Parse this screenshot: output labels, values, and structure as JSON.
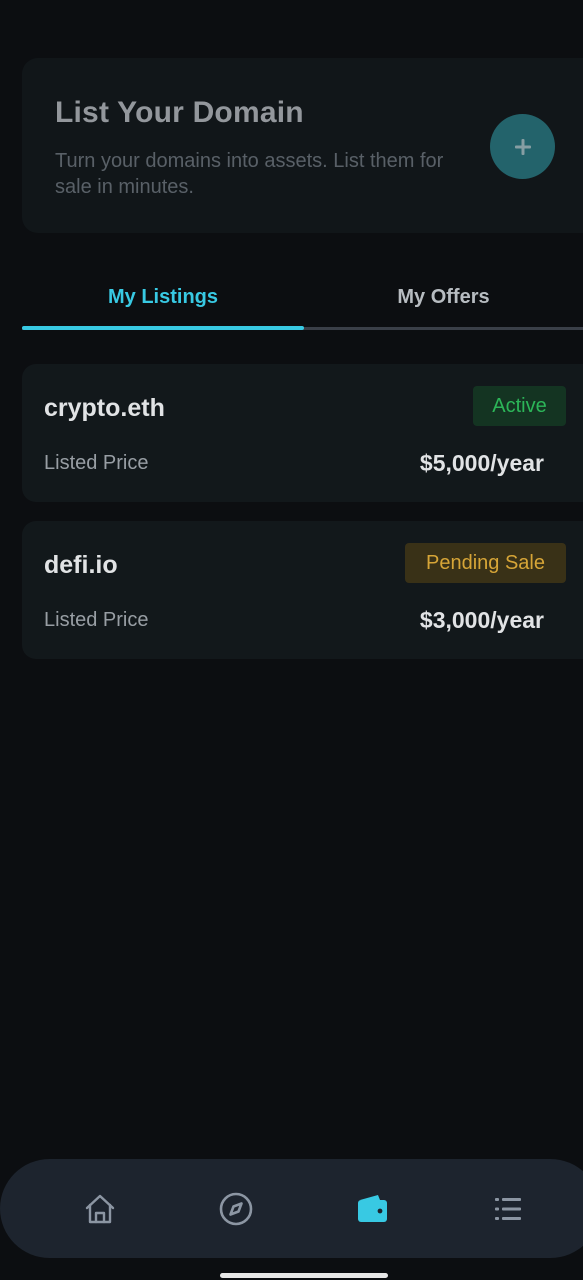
{
  "promo": {
    "title": "List Your Domain",
    "description": "Turn your domains into assets. List them for sale in minutes.",
    "add_icon": "plus-icon"
  },
  "tabs": [
    {
      "label": "My Listings",
      "active": true
    },
    {
      "label": "My Offers",
      "active": false
    }
  ],
  "listings": [
    {
      "domain": "crypto.eth",
      "status": "Active",
      "price_label": "Listed Price",
      "price": "$5,000/year"
    },
    {
      "domain": "defi.io",
      "status": "Pending Sale",
      "price_label": "Listed Price",
      "price": "$3,000/year"
    }
  ],
  "nav": {
    "items": [
      {
        "icon": "home-icon",
        "active": false
      },
      {
        "icon": "compass-icon",
        "active": false
      },
      {
        "icon": "wallet-icon",
        "active": true
      },
      {
        "icon": "list-icon",
        "active": false
      }
    ]
  },
  "colors": {
    "accent": "#38c9e3",
    "background": "#0c0e11",
    "card": "#13191c",
    "active_status": "#2fc45f",
    "pending_status": "#e8b23b"
  }
}
